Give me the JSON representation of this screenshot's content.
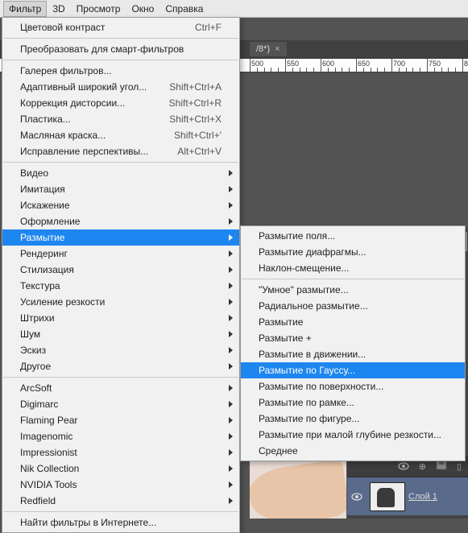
{
  "menubar": {
    "items": [
      "Фильтр",
      "3D",
      "Просмотр",
      "Окно",
      "Справка"
    ],
    "active_index": 0
  },
  "tab": {
    "label": "/8*)",
    "close": "×"
  },
  "ruler": {
    "start": 500,
    "step": 50,
    "count": 7
  },
  "filter_menu": {
    "sections": [
      [
        {
          "label": "Цветовой контраст",
          "shortcut": "Ctrl+F"
        }
      ],
      [
        {
          "label": "Преобразовать для смарт-фильтров"
        }
      ],
      [
        {
          "label": "Галерея фильтров..."
        },
        {
          "label": "Адаптивный широкий угол...",
          "shortcut": "Shift+Ctrl+A"
        },
        {
          "label": "Коррекция дисторсии...",
          "shortcut": "Shift+Ctrl+R"
        },
        {
          "label": "Пластика...",
          "shortcut": "Shift+Ctrl+X"
        },
        {
          "label": "Масляная краска...",
          "shortcut": "Shift+Ctrl+'"
        },
        {
          "label": "Исправление перспективы...",
          "shortcut": "Alt+Ctrl+V"
        }
      ],
      [
        {
          "label": "Видео",
          "submenu": true
        },
        {
          "label": "Имитация",
          "submenu": true
        },
        {
          "label": "Искажение",
          "submenu": true
        },
        {
          "label": "Оформление",
          "submenu": true
        },
        {
          "label": "Размытие",
          "submenu": true,
          "highlight": true
        },
        {
          "label": "Рендеринг",
          "submenu": true
        },
        {
          "label": "Стилизация",
          "submenu": true
        },
        {
          "label": "Текстура",
          "submenu": true
        },
        {
          "label": "Усиление резкости",
          "submenu": true
        },
        {
          "label": "Штрихи",
          "submenu": true
        },
        {
          "label": "Шум",
          "submenu": true
        },
        {
          "label": "Эскиз",
          "submenu": true
        },
        {
          "label": "Другое",
          "submenu": true
        }
      ],
      [
        {
          "label": "ArcSoft",
          "submenu": true
        },
        {
          "label": "Digimarc",
          "submenu": true
        },
        {
          "label": "Flaming Pear",
          "submenu": true
        },
        {
          "label": "Imagenomic",
          "submenu": true
        },
        {
          "label": "Impressionist",
          "submenu": true
        },
        {
          "label": "Nik Collection",
          "submenu": true
        },
        {
          "label": "NVIDIA Tools",
          "submenu": true
        },
        {
          "label": "Redfield",
          "submenu": true
        }
      ],
      [
        {
          "label": "Найти фильтры в Интернете..."
        }
      ]
    ]
  },
  "blur_submenu": {
    "sections": [
      [
        {
          "label": "Размытие поля..."
        },
        {
          "label": "Размытие диафрагмы..."
        },
        {
          "label": "Наклон-смещение..."
        }
      ],
      [
        {
          "label": "\"Умное\" размытие..."
        },
        {
          "label": "Радиальное размытие..."
        },
        {
          "label": "Размытие"
        },
        {
          "label": "Размытие +"
        },
        {
          "label": "Размытие в движении..."
        },
        {
          "label": "Размытие по Гауссу...",
          "highlight": true
        },
        {
          "label": "Размытие по поверхности..."
        },
        {
          "label": "Размытие по рамке..."
        },
        {
          "label": "Размытие по фигуре..."
        },
        {
          "label": "Размытие при малой глубине резкости..."
        },
        {
          "label": "Среднее"
        }
      ]
    ]
  },
  "layers": {
    "row": {
      "name": "Слой 1"
    },
    "icons": {
      "eye": "●",
      "lock": "⊕",
      "save": "▭"
    }
  }
}
